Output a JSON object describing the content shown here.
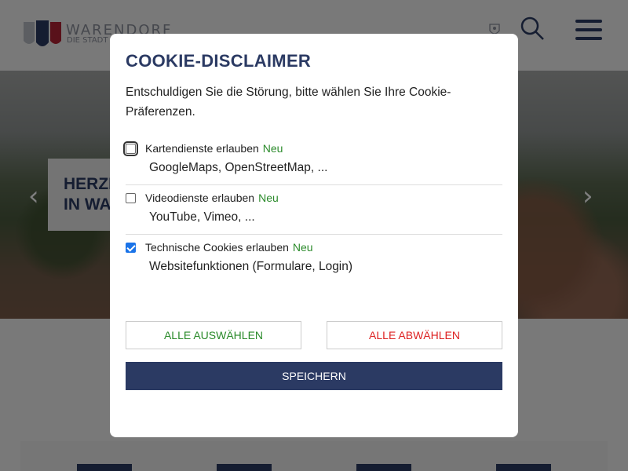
{
  "header": {
    "logo_title": "WARENDORF",
    "logo_sub": "DIE STADT",
    "crest_icon": "crest-icon",
    "search_icon": "search-icon",
    "menu_icon": "hamburger-menu-icon",
    "accent_color": "#2b3a63"
  },
  "hero": {
    "caption_line1": "HERZL",
    "caption_line2": "IN WA",
    "prev_icon": "chevron-left-icon",
    "next_icon": "chevron-right-icon",
    "prev_glyph": "‹",
    "next_glyph": "›"
  },
  "cookie_dialog": {
    "title": "COOKIE-DISCLAIMER",
    "intro": "Entschuldigen Sie die Störung, bitte wählen Sie Ihre Cookie-Präferenzen.",
    "options": [
      {
        "label": "Kartendienste erlauben",
        "badge": "Neu",
        "description": "GoogleMaps, OpenStreetMap, ...",
        "checked": false
      },
      {
        "label": "Videodienste erlauben",
        "badge": "Neu",
        "description": "YouTube, Vimeo, ...",
        "checked": false
      },
      {
        "label": "Technische Cookies erlauben",
        "badge": "Neu",
        "description": "Websitefunktionen (Formulare, Login)",
        "checked": true
      }
    ],
    "select_all": "ALLE AUSWÄHLEN",
    "deselect_all": "ALLE ABWÄHLEN",
    "save": "SPEICHERN",
    "colors": {
      "new_badge": "#2a8a2a",
      "deselect": "#d22222",
      "save_bg": "#2b3a63"
    }
  }
}
